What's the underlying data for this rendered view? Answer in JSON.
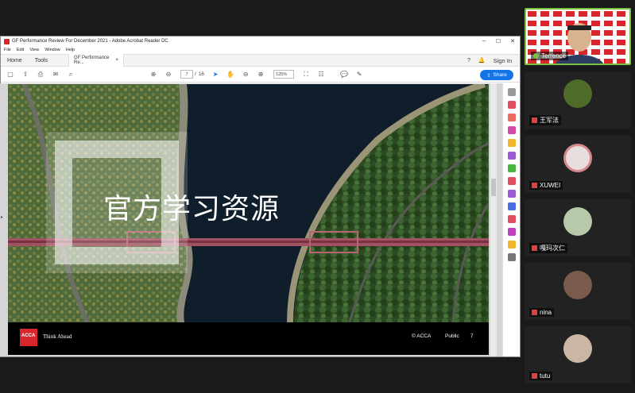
{
  "acrobat": {
    "title": "GF Performance Review  For December 2021 - Adobe Acrobat Reader DC",
    "menu": [
      "File",
      "Edit",
      "View",
      "Window",
      "Help"
    ],
    "tabs": {
      "home": "Home",
      "tools": "Tools",
      "doc": "GF Performance Re...",
      "close": "×"
    },
    "signin": "Sign In",
    "toolbar": {
      "page_current": "7",
      "page_sep": "/",
      "page_total": "16",
      "zoom": "125%",
      "share": "Share"
    }
  },
  "slide": {
    "heading": "官方学习资源",
    "brand": "ACCA",
    "tagline": "Think Ahead",
    "copyright": "© ACCA",
    "classification": "Public",
    "page": "7"
  },
  "participants": [
    {
      "name": "Terrence",
      "active": true
    },
    {
      "name": "王军法"
    },
    {
      "name": "XUWEI"
    },
    {
      "name": "嘎玛次仁"
    },
    {
      "name": "nina"
    },
    {
      "name": "tutu"
    }
  ],
  "colors": {
    "accent": "#1473e6",
    "acca_red": "#d8262d",
    "speaking": "#7bc142"
  }
}
